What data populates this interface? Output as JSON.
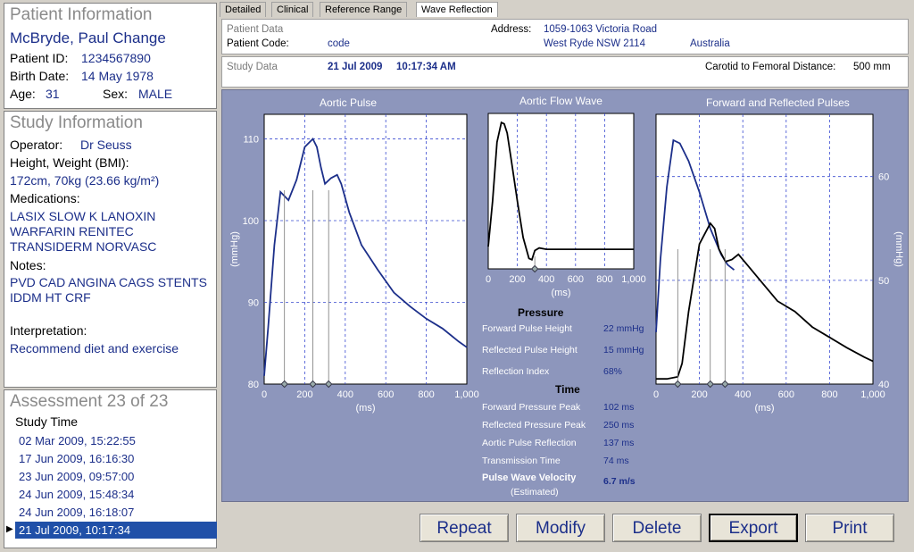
{
  "patient": {
    "section_title": "Patient Information",
    "name": "McBryde, Paul Change",
    "id_label": "Patient ID:",
    "id_value": "1234567890",
    "birth_label": "Birth Date:",
    "birth_value": "14 May 1978",
    "age_label": "Age:",
    "age_value": "31",
    "sex_label": "Sex:",
    "sex_value": "MALE"
  },
  "study": {
    "section_title": "Study Information",
    "operator_label": "Operator:",
    "operator_value": "Dr Seuss",
    "hw_label": "Height, Weight (BMI):",
    "hw_value": "172cm, 70kg (23.66 kg/m²)",
    "medications_label": "Medications:",
    "medications": [
      "LASIX SLOW K LANOXIN",
      "WARFARIN  RENITEC",
      "TRANSIDERM NORVASC"
    ],
    "notes_label": "Notes:",
    "notes": [
      "PVD CAD ANGINA CAGS STENTS",
      "IDDM HT CRF"
    ],
    "interpretation_label": "Interpretation:",
    "interpretation_value": "Recommend diet and exercise"
  },
  "assessment": {
    "title": "Assessment 23 of 23",
    "column_header": "Study Time",
    "rows": [
      "02 Mar 2009, 15:22:55",
      "17 Jun 2009, 16:16:30",
      "23 Jun 2009, 09:57:00",
      "24 Jun 2009, 15:48:34",
      "24 Jun 2009, 16:18:07",
      "21 Jul 2009, 10:17:34"
    ],
    "selected_index": 5
  },
  "tabs": [
    "Detailed",
    "Clinical",
    "Reference Range",
    "Wave Reflection"
  ],
  "active_tab": "Wave Reflection",
  "header": {
    "patient_data_label": "Patient Data",
    "patient_code_label": "Patient Code:",
    "patient_code_value": "code",
    "address_label": "Address:",
    "address_line1": "1059-1063 Victoria Road",
    "address_line2": "West Ryde NSW 2114",
    "country": "Australia",
    "study_data_label": "Study Data",
    "study_date": "21 Jul 2009",
    "study_time": "10:17:34 AM",
    "distance_label": "Carotid to Femoral Distance:",
    "distance_value": "500 mm"
  },
  "graphs": {
    "aortic_title": "Aortic Pulse",
    "flow_title": "Aortic Flow Wave",
    "forward_title": "Forward and Reflected Pulses",
    "aortic_ylabel": "(mmHg)",
    "forward_ylabel": "(mmHg)",
    "xlabel": "(ms)",
    "x_ticks": [
      "0",
      "200",
      "400",
      "600",
      "800",
      "1,000"
    ],
    "aortic_y_ticks": [
      "80",
      "90",
      "100",
      "110"
    ],
    "forward_y_ticks": [
      "40",
      "50",
      "60"
    ]
  },
  "chart_data": [
    {
      "type": "line",
      "title": "Aortic Pulse",
      "xlabel": "(ms)",
      "ylabel": "(mmHg)",
      "xlim": [
        0,
        1000
      ],
      "ylim": [
        80,
        113
      ],
      "series": [
        {
          "color": "#1c2f8a",
          "x": [
            0,
            20,
            50,
            80,
            100,
            120,
            160,
            200,
            240,
            260,
            280,
            300,
            330,
            360,
            380,
            420,
            480,
            560,
            640,
            720,
            800,
            880,
            960,
            1000
          ],
          "y": [
            81,
            87,
            97,
            103.5,
            103,
            102.5,
            105,
            109,
            110,
            109,
            106.5,
            104.5,
            105.2,
            105.6,
            104.5,
            101,
            97,
            94,
            91.2,
            89.5,
            88,
            86.8,
            85.2,
            84.5
          ]
        }
      ],
      "markers_x": [
        100,
        240,
        318
      ]
    },
    {
      "type": "line",
      "title": "Aortic Flow Wave",
      "xlabel": "(ms)",
      "xlim": [
        0,
        1000
      ],
      "series": [
        {
          "color": "#000000",
          "x": [
            0,
            30,
            60,
            90,
            110,
            130,
            160,
            200,
            240,
            280,
            300,
            320,
            350,
            400,
            600,
            800,
            1000
          ],
          "y": [
            0.05,
            0.4,
            0.85,
            1.0,
            0.99,
            0.92,
            0.7,
            0.4,
            0.12,
            -0.04,
            -0.05,
            0.02,
            0.04,
            0.03,
            0.03,
            0.03,
            0.03
          ]
        }
      ],
      "markers_x": [
        320
      ]
    },
    {
      "type": "line",
      "title": "Forward and Reflected Pulses",
      "xlabel": "(ms)",
      "ylabel": "(mmHg)",
      "xlim": [
        0,
        1000
      ],
      "ylim": [
        40,
        66
      ],
      "series": [
        {
          "name": "Forward",
          "color": "#1c2f8a",
          "x": [
            0,
            20,
            50,
            80,
            110,
            150,
            200,
            250,
            300,
            330,
            360
          ],
          "y": [
            45,
            52,
            59,
            63.5,
            63.2,
            61.5,
            58.5,
            55,
            52.5,
            51.5,
            51
          ]
        },
        {
          "name": "Reflected",
          "color": "#000000",
          "x": [
            0,
            50,
            100,
            120,
            150,
            200,
            250,
            270,
            290,
            320,
            350,
            380,
            420,
            480,
            560,
            640,
            720,
            800,
            880,
            960,
            1000
          ],
          "y": [
            40.5,
            40.5,
            40.7,
            42,
            47,
            53.5,
            55.5,
            55,
            53,
            51.8,
            52,
            52.5,
            51.5,
            50,
            48,
            47,
            45.5,
            44.5,
            43.5,
            42.6,
            42.2
          ]
        }
      ],
      "markers_x": [
        100,
        250,
        318
      ]
    }
  ],
  "pressure": {
    "heading": "Pressure",
    "rows": [
      {
        "label": "Forward Pulse Height",
        "value": "22 mmHg"
      },
      {
        "label": "Reflected Pulse Height",
        "value": "15 mmHg"
      },
      {
        "label": "Reflection Index",
        "value": "68%"
      }
    ]
  },
  "time": {
    "heading": "Time",
    "rows": [
      {
        "label": "Forward Pressure Peak",
        "value": "102 ms"
      },
      {
        "label": "Reflected Pressure Peak",
        "value": "250 ms"
      },
      {
        "label": "Aortic Pulse Reflection",
        "value": "137 ms"
      },
      {
        "label": "Transmission Time",
        "value": "74 ms"
      }
    ]
  },
  "pwv": {
    "label": "Pulse Wave Velocity",
    "sublabel": "(Estimated)",
    "value": "6.7 m/s"
  },
  "buttons": {
    "repeat": "Repeat",
    "modify": "Modify",
    "delete": "Delete",
    "export": "Export",
    "print": "Print"
  },
  "colors": {
    "graph_background": "#8d96bc",
    "accent_blue": "#1c2f8a",
    "selection": "#2050a8"
  }
}
